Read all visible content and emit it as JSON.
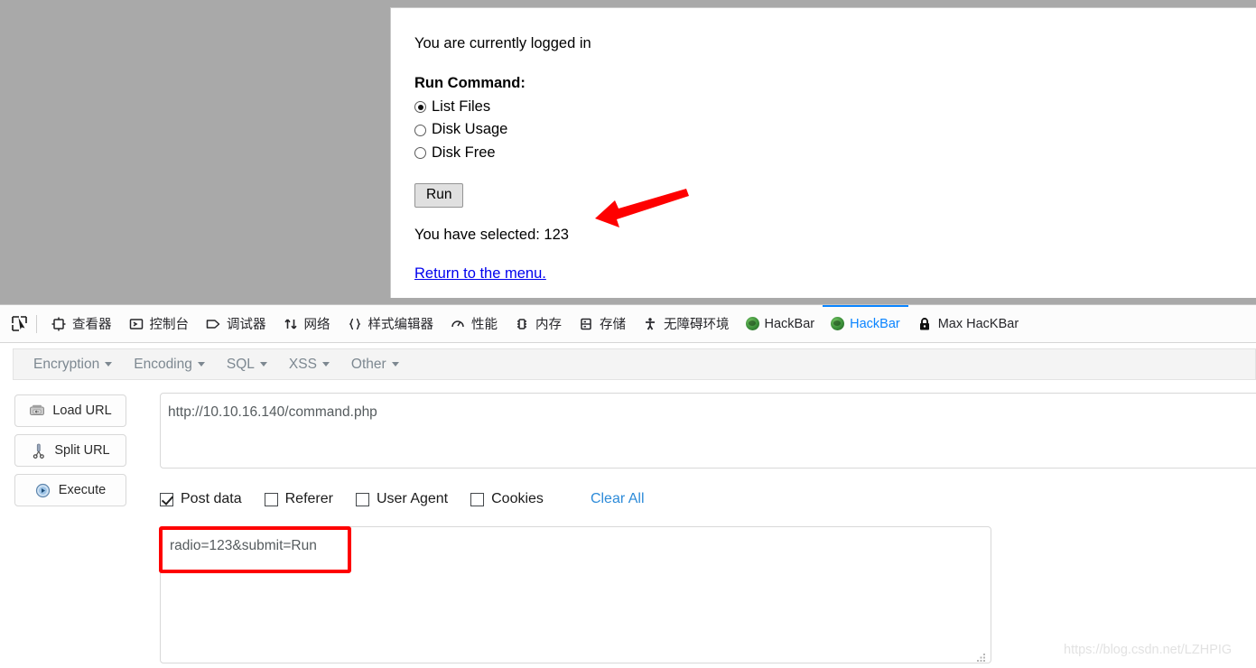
{
  "webpage": {
    "logged_in_text": "You are currently logged in",
    "command_heading": "Run Command:",
    "radios": [
      {
        "label": "List Files",
        "checked": true
      },
      {
        "label": "Disk Usage",
        "checked": false
      },
      {
        "label": "Disk Free",
        "checked": false
      }
    ],
    "run_button": "Run",
    "selected_text": "You have selected: 123",
    "return_link": "Return to the menu."
  },
  "devtools": {
    "picker_icon": "element-picker-icon",
    "tabs": [
      {
        "label": "查看器",
        "icon": "inspector-icon",
        "active": false
      },
      {
        "label": "控制台",
        "icon": "console-icon",
        "active": false
      },
      {
        "label": "调试器",
        "icon": "debugger-icon",
        "active": false
      },
      {
        "label": "网络",
        "icon": "network-icon",
        "active": false
      },
      {
        "label": "样式编辑器",
        "icon": "style-editor-icon",
        "active": false
      },
      {
        "label": "性能",
        "icon": "performance-icon",
        "active": false
      },
      {
        "label": "内存",
        "icon": "memory-icon",
        "active": false
      },
      {
        "label": "存储",
        "icon": "storage-icon",
        "active": false
      },
      {
        "label": "无障碍环境",
        "icon": "accessibility-icon",
        "active": false
      },
      {
        "label": "HackBar",
        "icon": "globe-icon",
        "active": false
      },
      {
        "label": "HackBar",
        "icon": "globe-icon",
        "active": true
      },
      {
        "label": "Max HacKBar",
        "icon": "lock-icon",
        "active": false
      }
    ],
    "active_color": "#0a84ff"
  },
  "hackbar": {
    "menu": [
      {
        "label": "Encryption"
      },
      {
        "label": "Encoding"
      },
      {
        "label": "SQL"
      },
      {
        "label": "XSS"
      },
      {
        "label": "Other"
      }
    ],
    "buttons": [
      {
        "label": "Load URL",
        "icon": "load-url-icon"
      },
      {
        "label": "Split URL",
        "icon": "scissors-icon"
      },
      {
        "label": "Execute",
        "icon": "play-icon"
      }
    ],
    "url_value": "http://10.10.16.140/command.php",
    "url_placeholder": "",
    "options": [
      {
        "label": "Post data",
        "checked": true
      },
      {
        "label": "Referer",
        "checked": false
      },
      {
        "label": "User Agent",
        "checked": false
      },
      {
        "label": "Cookies",
        "checked": false
      }
    ],
    "clear_all": "Clear All",
    "post_data_value": "radio=123&submit=Run",
    "post_data_placeholder": ""
  },
  "annotations": {
    "arrow_color": "#fe0000",
    "box_color": "#fe0000"
  },
  "watermark": "https://blog.csdn.net/LZHPIG"
}
